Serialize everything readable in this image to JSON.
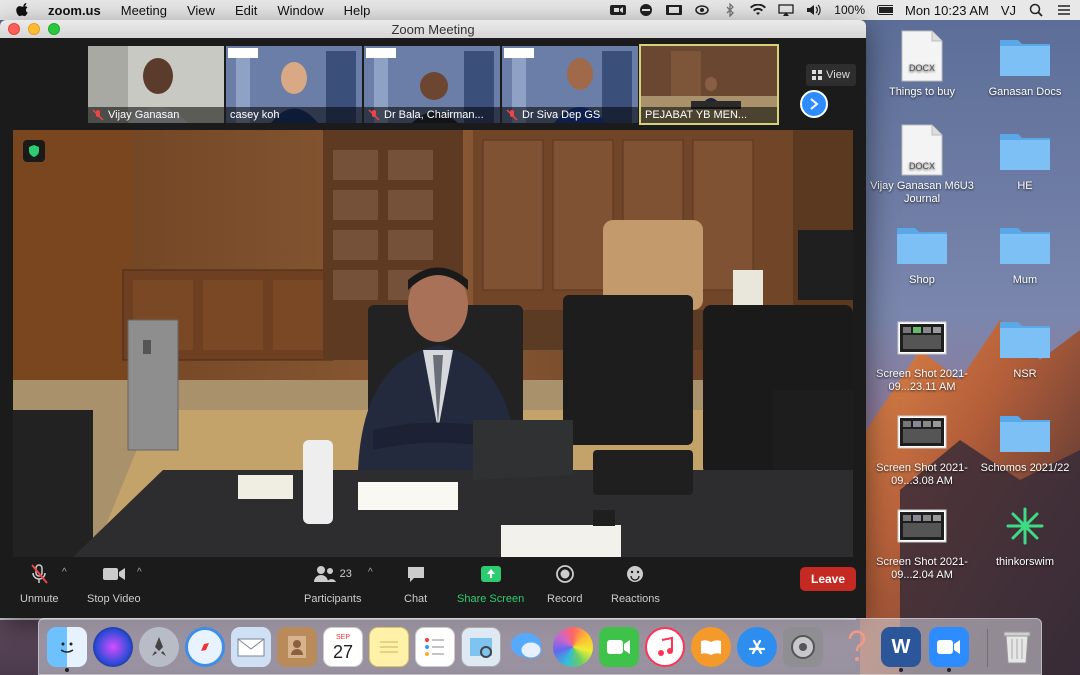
{
  "menubar": {
    "app_name": "zoom.us",
    "items": [
      "Meeting",
      "View",
      "Edit",
      "Window",
      "Help"
    ],
    "battery": "100%",
    "clock": "Mon 10:23 AM",
    "user": "VJ"
  },
  "window": {
    "title": "Zoom Meeting"
  },
  "thumbnails": [
    {
      "name": "Vijay Ganasan",
      "muted": true
    },
    {
      "name": "casey koh",
      "muted": false
    },
    {
      "name": "Dr Bala, Chairman...",
      "muted": true
    },
    {
      "name": "Dr Siva Dep GS",
      "muted": true
    },
    {
      "name": "PEJABAT YB MEN...",
      "muted": false,
      "active": true
    }
  ],
  "view_button": "View",
  "toolbar": {
    "unmute": "Unmute",
    "stop_video": "Stop Video",
    "participants": "Participants",
    "participants_count": "23",
    "chat": "Chat",
    "share_screen": "Share Screen",
    "record": "Record",
    "reactions": "Reactions",
    "leave": "Leave"
  },
  "desktop_icons": [
    {
      "name": "Things to buy",
      "type": "docx",
      "badge": "DOCX"
    },
    {
      "name": "Ganasan Docs",
      "type": "folder"
    },
    {
      "name": "Vijay Ganasan M6U3 Journal",
      "type": "docx",
      "badge": "DOCX"
    },
    {
      "name": "HE",
      "type": "folder"
    },
    {
      "name": "Shop",
      "type": "folder"
    },
    {
      "name": "Mum",
      "type": "folder"
    },
    {
      "name": "Screen Shot 2021-09...23.11 AM",
      "type": "screenshot"
    },
    {
      "name": "NSR",
      "type": "folder"
    },
    {
      "name": "Screen Shot 2021-09...3.08 AM",
      "type": "screenshot"
    },
    {
      "name": "Schomos 2021/22",
      "type": "folder"
    },
    {
      "name": "Screen Shot 2021-09...2.04 AM",
      "type": "screenshot"
    },
    {
      "name": "thinkorswim",
      "type": "app"
    }
  ],
  "dock": {
    "apps": [
      "finder-icon",
      "siri-icon",
      "launchpad-icon",
      "safari-icon",
      "mail-icon",
      "contacts-icon",
      "calendar-icon",
      "notes-icon",
      "reminders-icon",
      "preview-icon",
      "messages-icon",
      "photos-icon",
      "facetime-icon",
      "music-icon",
      "books-icon",
      "app-store-icon",
      "system-preferences-icon",
      "help-icon",
      "word-icon",
      "zoom-icon",
      "trash-icon"
    ],
    "calendar_month": "SEP",
    "calendar_day": "27",
    "word_letter": "W"
  }
}
